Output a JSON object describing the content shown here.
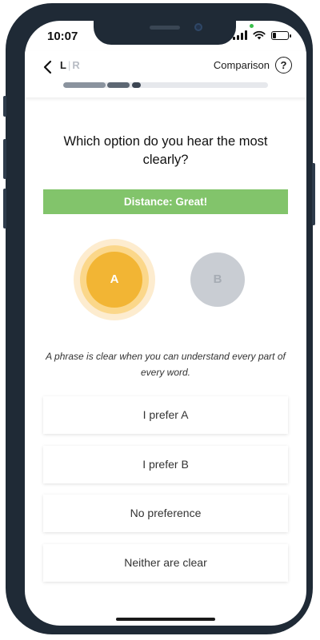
{
  "status_bar": {
    "time": "10:07"
  },
  "header": {
    "ear_left": "L",
    "ear_separator": "|",
    "ear_right": "R",
    "title": "Comparison",
    "help_label": "?"
  },
  "progress": {
    "segments_completed": 3,
    "value": 0.38,
    "colors": [
      "#8a939e",
      "#5d6773",
      "#3c4552"
    ]
  },
  "question": "Which option do you hear the most clearly?",
  "distance_banner": "Distance: Great!",
  "options": {
    "a": "A",
    "b": "B",
    "active": "A"
  },
  "hint": "A phrase is clear when you can understand every part of every word.",
  "choices": [
    "I prefer A",
    "I prefer B",
    "No preference",
    "Neither are clear"
  ],
  "colors": {
    "banner": "#82c46b",
    "option_a": "#f2b534",
    "option_b": "#c9cdd3",
    "frame": "#1f2a36"
  }
}
